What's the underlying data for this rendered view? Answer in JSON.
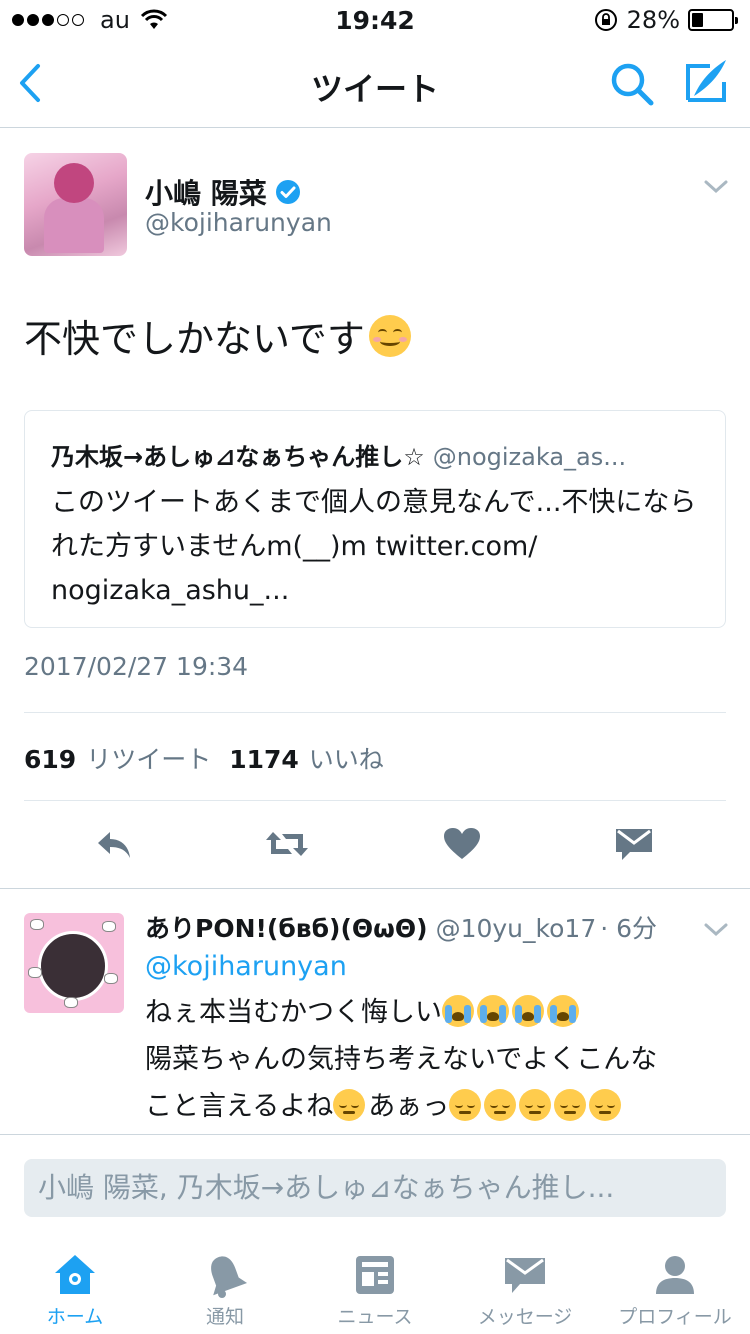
{
  "status_bar": {
    "carrier": "au",
    "time": "19:42",
    "battery": "28%",
    "battery_level": 0.28
  },
  "nav": {
    "title": "ツイート",
    "icons": [
      "back-chevron-icon",
      "search-icon",
      "compose-icon"
    ]
  },
  "tweet": {
    "name": "小嶋 陽菜",
    "handle": "@kojiharunyan",
    "text": "不快でしかないです",
    "quote": {
      "name": "乃木坂→あしゅ⊿なぁちゃん推し☆",
      "handle": "@nogizaka_as...",
      "text": "このツイートあくまで個人の意見なんで...不快になられた方すいませんm(__)m twitter.com/\nnogizaka_ashu_..."
    },
    "timestamp": "2017/02/27 19:34",
    "retweet_count": "619",
    "retweet_label": "リツイート",
    "like_count": "1174",
    "like_label": "いいね"
  },
  "reply": {
    "name": "ありPON!(бвб)(ΘωΘ)",
    "handle": "@10yu_ko17",
    "time": "· 6分",
    "mention": "@kojiharunyan",
    "line1": "ねぇ本当むかつく悔しい",
    "line2": "陽菜ちゃんの気持ち考えないでよくこんな",
    "line3": "こと言えるよね",
    "line3b": "あぁっ"
  },
  "compose": {
    "placeholder": "小嶋 陽菜, 乃木坂→あしゅ⊿なぁちゃん推し..."
  },
  "tabs": [
    {
      "label": "ホーム",
      "icon": "home-icon",
      "active": true
    },
    {
      "label": "通知",
      "icon": "bell-icon",
      "active": false
    },
    {
      "label": "ニュース",
      "icon": "news-icon",
      "active": false
    },
    {
      "label": "メッセージ",
      "icon": "envelope-icon",
      "active": false
    },
    {
      "label": "プロフィール",
      "icon": "person-icon",
      "active": false
    }
  ],
  "colors": {
    "accent": "#1da1f2",
    "secondary_text": "#657786",
    "border": "#e1e8ed"
  }
}
